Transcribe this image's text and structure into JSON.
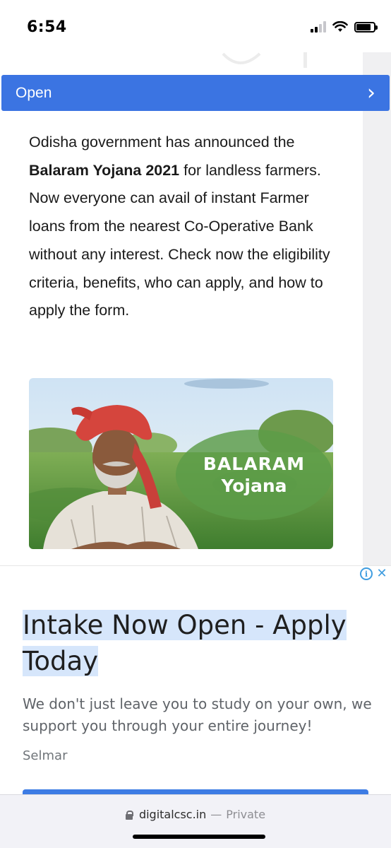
{
  "status_bar": {
    "time": "6:54",
    "signal_bars_active": 2,
    "signal_bars_total": 4,
    "battery_level": 0.82
  },
  "page": {
    "open_bar": {
      "label": "Open",
      "chevron": "›",
      "icon": "chevron-right-icon",
      "color": "#3b74e2"
    },
    "article": {
      "intro": "Odisha government has announced the ",
      "highlight": "Balaram Yojana 2021",
      "rest": " for landless farmers. Now everyone can avail of instant Farmer loans from the nearest Co-Operative Bank without any interest. Check now the eligibility criteria, benefits, who can apply, and how to apply the form."
    },
    "hero_image": {
      "badge_line1": "BALARAM",
      "badge_line2": "Yojana"
    }
  },
  "ad": {
    "info_icon": "i",
    "close_icon": "✕",
    "headline_line1": "Intake Now Open - Apply",
    "headline_line2": "Today",
    "body": "We don't just leave you to study on your own, we support you through your entire journey!",
    "advertiser": "Selmar",
    "accent_color": "#3d7ce4"
  },
  "bottom_bar": {
    "domain": "digitalcsc.in",
    "separator": "—",
    "mode": "Private"
  }
}
